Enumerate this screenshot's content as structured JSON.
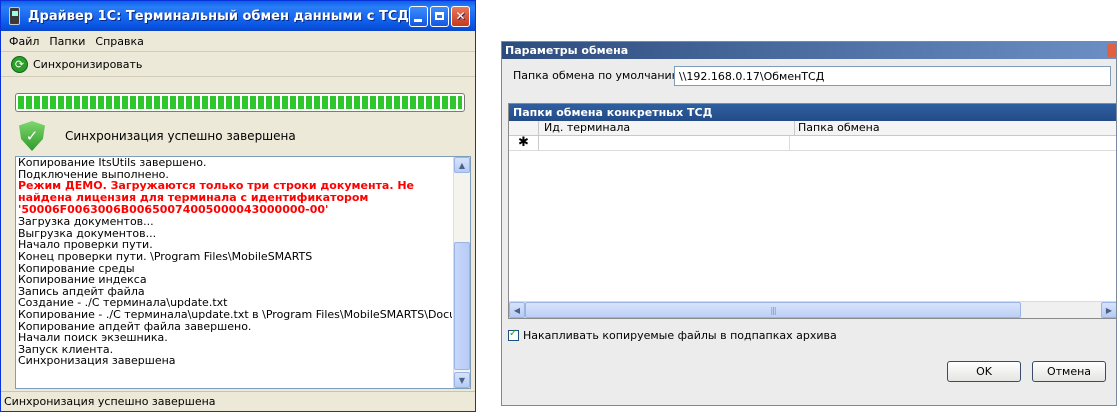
{
  "main_window": {
    "title": "Драйвер 1С: Терминальный обмен данными с ТСД",
    "menu": [
      "Файл",
      "Папки",
      "Справка"
    ],
    "sync_button_label": "Синхронизировать",
    "progress": 1.0,
    "status_message": "Синхронизация успешно завершена",
    "log_lines_before": [
      "Копирование ItsUtils завершено.",
      "Подключение выполнено."
    ],
    "log_error": "Режим ДЕМО. Загружаются только три строки документа. Не найдена лицензия для терминала с идентификатором '50006F0063006B00650074005000043000000-00'",
    "log_lines_after": [
      "Загрузка документов...",
      "Выгрузка документов...",
      "Начало проверки пути.",
      "Конец проверки пути. \\Program Files\\MobileSMARTS",
      "Копирование среды",
      "Копирование индекса",
      "Запись апдейт файла",
      "Создание - ./С терминала\\update.txt",
      "Копирование - ./С терминала\\update.txt в \\Program Files\\MobileSMARTS\\Documents",
      "Копирование апдейт файла завершено.",
      "Начали поиск экзешника.",
      "Запуск клиента.",
      "Синхронизация завершена"
    ],
    "statusbar_text": "Синхронизация успешно завершена"
  },
  "params_dialog": {
    "title": "Параметры обмена",
    "default_folder_label": "Папка обмена по умолчанию:",
    "default_folder_value": "\\\\192.168.0.17\\ОбменТСД",
    "grid_title": "Папки обмена конкретных ТСД",
    "columns": [
      "Ид. терминала",
      "Папка обмена"
    ],
    "new_row_marker": "✱",
    "accumulate_checkbox_label": "Накапливать копируемые файлы в подпапках архива",
    "accumulate_checked": true,
    "ok_label": "OK",
    "cancel_label": "Отмена"
  },
  "icons": {
    "sync": "sync-icon",
    "status": "shield-check-icon"
  },
  "colors": {
    "error_text": "#ff0000",
    "progress": "#2ec52e",
    "titlebar": "#0a5fe8"
  }
}
